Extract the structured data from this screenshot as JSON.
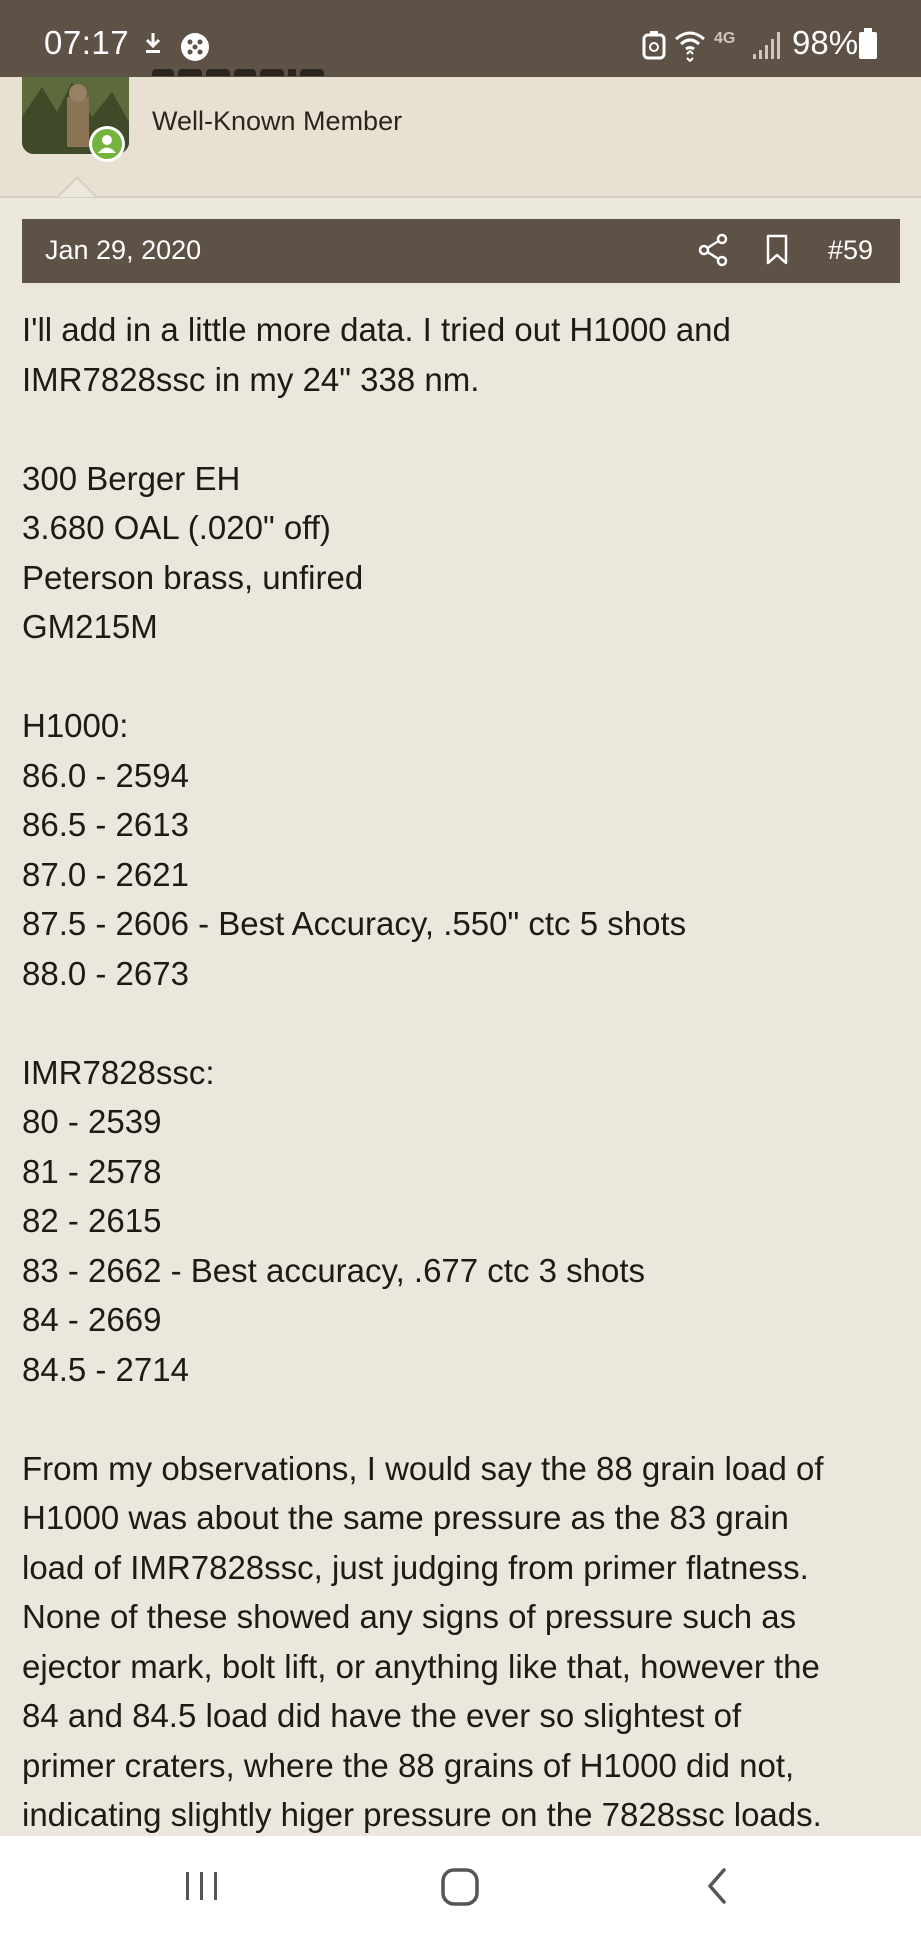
{
  "status_bar": {
    "time": "07:17",
    "icons": [
      "download-icon",
      "game-icon",
      "battery-saver-icon",
      "wifi-icon",
      "network-4g-icon",
      "signal-icon"
    ],
    "network": "4G",
    "battery": "98%"
  },
  "member": {
    "role": "Well-Known Member",
    "online": true
  },
  "post": {
    "date": "Jan 29, 2020",
    "number": "#59",
    "paragraphs": [
      [
        "I'll add in a little more data. I tried out H1000 and",
        "IMR7828ssc in my 24\" 338 nm."
      ],
      [
        "300 Berger EH",
        "3.680 OAL (.020\" off)",
        "Peterson brass, unfired",
        "GM215M"
      ],
      [
        "H1000:",
        "86.0 - 2594",
        "86.5 - 2613",
        "87.0 - 2621",
        "87.5 - 2606 - Best Accuracy, .550\" ctc 5 shots",
        "88.0 - 2673"
      ],
      [
        "IMR7828ssc:",
        "80 - 2539",
        "81 - 2578",
        "82 - 2615",
        "83 - 2662 - Best accuracy, .677 ctc 3 shots",
        "84 - 2669",
        "84.5 - 2714"
      ],
      [
        "From my observations, I would say the 88 grain load of",
        "H1000 was about the same pressure as the 83 grain",
        "load of IMR7828ssc, just judging from primer flatness.",
        "None of these showed any signs of pressure such as",
        "ejector mark, bolt lift, or anything like that, however the",
        "84 and 84.5 load did have the ever so slightest of",
        "primer craters, where the 88 grains of H1000 did not,",
        "indicating slightly higer pressure on the 7828ssc loads."
      ]
    ]
  },
  "nav": {
    "buttons": [
      "recent-apps-icon",
      "home-icon",
      "back-icon"
    ]
  },
  "colors": {
    "bar": "#5e5145",
    "page_bg": "#ece7dd",
    "member_bg": "#e8e1d2",
    "online": "#74b33e"
  }
}
